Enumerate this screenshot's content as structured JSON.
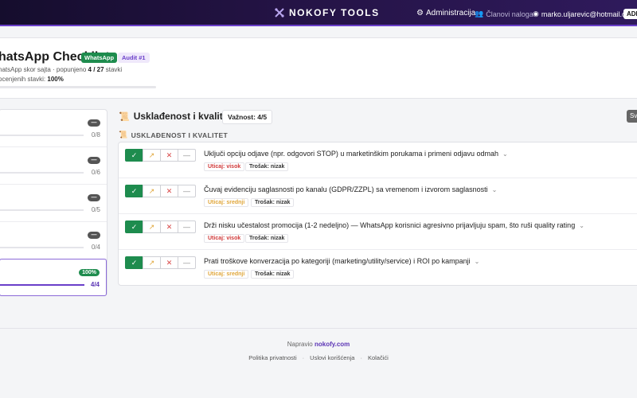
{
  "topbar": {
    "brand": "NOKOFY TOOLS",
    "admin_label": "Administracija",
    "members_label": "Članovi naloga",
    "user_email": "marko.uljarevic@hotmail.com",
    "role_badge": "ADM"
  },
  "header": {
    "title": "hatsApp Checklist",
    "platform_badge": "WhatsApp",
    "audit_badge": "Audit #1",
    "score_prefix": "hatsApp skor sajta · popunjeno ",
    "score_value": "4 / 27",
    "score_suffix": " stavki",
    "rated_prefix": "ocenjenih stavki: ",
    "rated_value": "100%",
    "progress_fraction": 0.01
  },
  "sidebar": {
    "items": [
      {
        "pill": "—",
        "count": "0/8",
        "fill": 0
      },
      {
        "pill": "—",
        "count": "0/6",
        "fill": 0
      },
      {
        "pill": "—",
        "count": "0/5",
        "fill": 0
      },
      {
        "pill": "—",
        "count": "0/4",
        "fill": 0
      },
      {
        "pill": "100%",
        "count": "4/4",
        "fill": 1
      }
    ]
  },
  "section": {
    "title": "Usklađenost i kvalitet",
    "importance": "Važnost: 4/5",
    "side_button": "Sv",
    "subheading": "USKLAĐENOST I KVALITET"
  },
  "buttons": {
    "ok": "✓",
    "partial": "↗",
    "no": "✕",
    "na": "—"
  },
  "items": [
    {
      "text": "Uključi opciju odjave (npr. odgovori STOP) u marketinškim porukama i primeni odjavu odmah",
      "impact": "Uticaj: visok",
      "impact_level": "high",
      "cost": "Trošak: nizak"
    },
    {
      "text": "Čuvaj evidenciju saglasnosti po kanalu (GDPR/ZZPL) sa vremenom i izvorom saglasnosti",
      "impact": "Uticaj: srednji",
      "impact_level": "mid",
      "cost": "Trošak: nizak"
    },
    {
      "text": "Drži nisku učestalost promocija (1-2 nedeljno) — WhatsApp korisnici agresivno prijavljuju spam, što ruši quality rating",
      "impact": "Uticaj: visok",
      "impact_level": "high",
      "cost": "Trošak: nizak"
    },
    {
      "text": "Prati troškove konverzacija po kategoriji (marketing/utility/service) i ROI po kampanji",
      "impact": "Uticaj: srednji",
      "impact_level": "mid",
      "cost": "Trošak: nizak"
    }
  ],
  "footer": {
    "made_by_prefix": "Napravio ",
    "made_by_link": "nokofy.com",
    "links": [
      "Politika privatnosti",
      "Uslovi korišćenja",
      "Kolačići"
    ],
    "separator": "·"
  }
}
